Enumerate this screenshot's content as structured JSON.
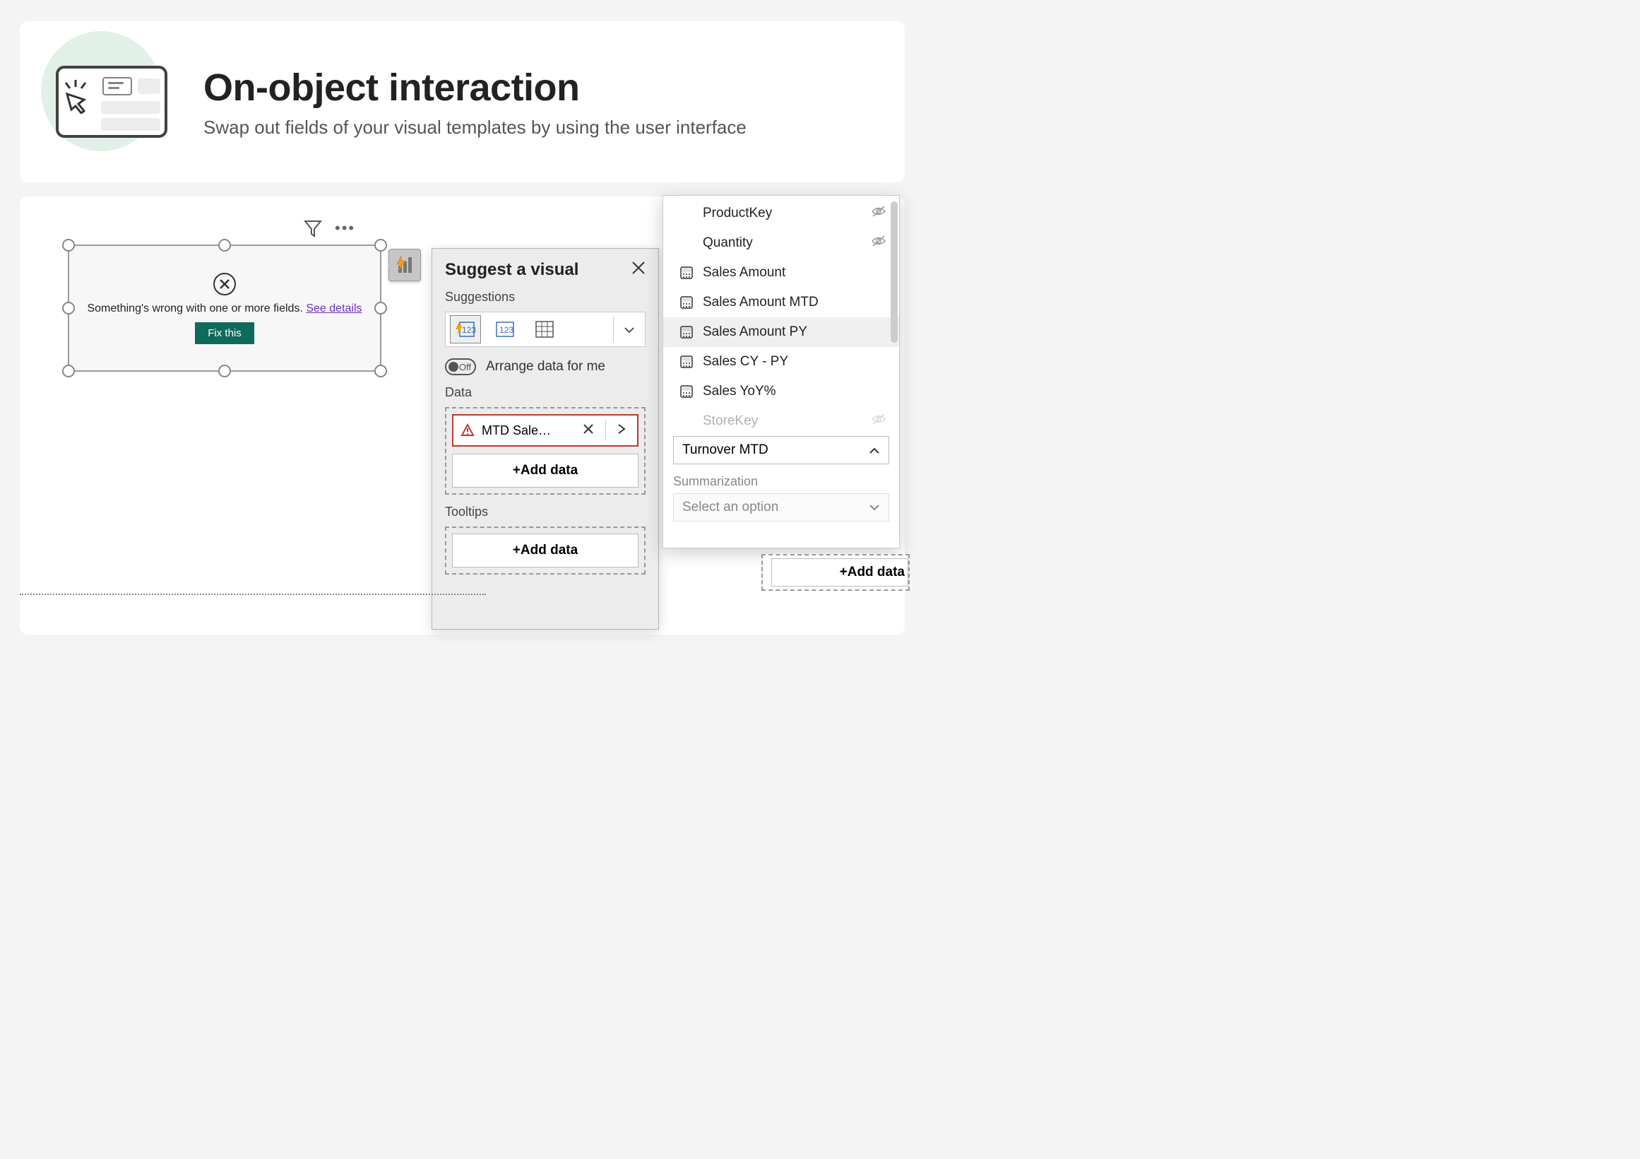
{
  "header": {
    "title": "On-object interaction",
    "subtitle": "Swap out fields of your visual templates by using the user interface"
  },
  "visual": {
    "error_message": "Something's wrong with one or more fields.",
    "see_details": "See details",
    "fix_button": "Fix this"
  },
  "suggest": {
    "title": "Suggest a visual",
    "suggestions_label": "Suggestions",
    "arrange_toggle_state": "Off",
    "arrange_label": "Arrange data for me",
    "data_label": "Data",
    "data_pill": "MTD Sale…",
    "add_data": "+Add data",
    "tooltips_label": "Tooltips"
  },
  "fields": {
    "items": [
      {
        "label": "ProductKey",
        "icon": "none-indent",
        "hidden": true
      },
      {
        "label": "Quantity",
        "icon": "none-indent",
        "hidden": true
      },
      {
        "label": "Sales Amount",
        "icon": "calc",
        "hidden": false
      },
      {
        "label": "Sales Amount MTD",
        "icon": "calc",
        "hidden": false
      },
      {
        "label": "Sales Amount PY",
        "icon": "calc",
        "hidden": false,
        "hovered": true
      },
      {
        "label": "Sales CY - PY",
        "icon": "calc",
        "hidden": false
      },
      {
        "label": "Sales YoY%",
        "icon": "calc",
        "hidden": false
      },
      {
        "label": "StoreKey",
        "icon": "none-indent",
        "hidden": true,
        "cut": true
      }
    ],
    "turnover_label": "Turnover MTD",
    "summarization_label": "Summarization",
    "summarization_placeholder": "Select an option"
  },
  "bottom_add": "+Add data"
}
